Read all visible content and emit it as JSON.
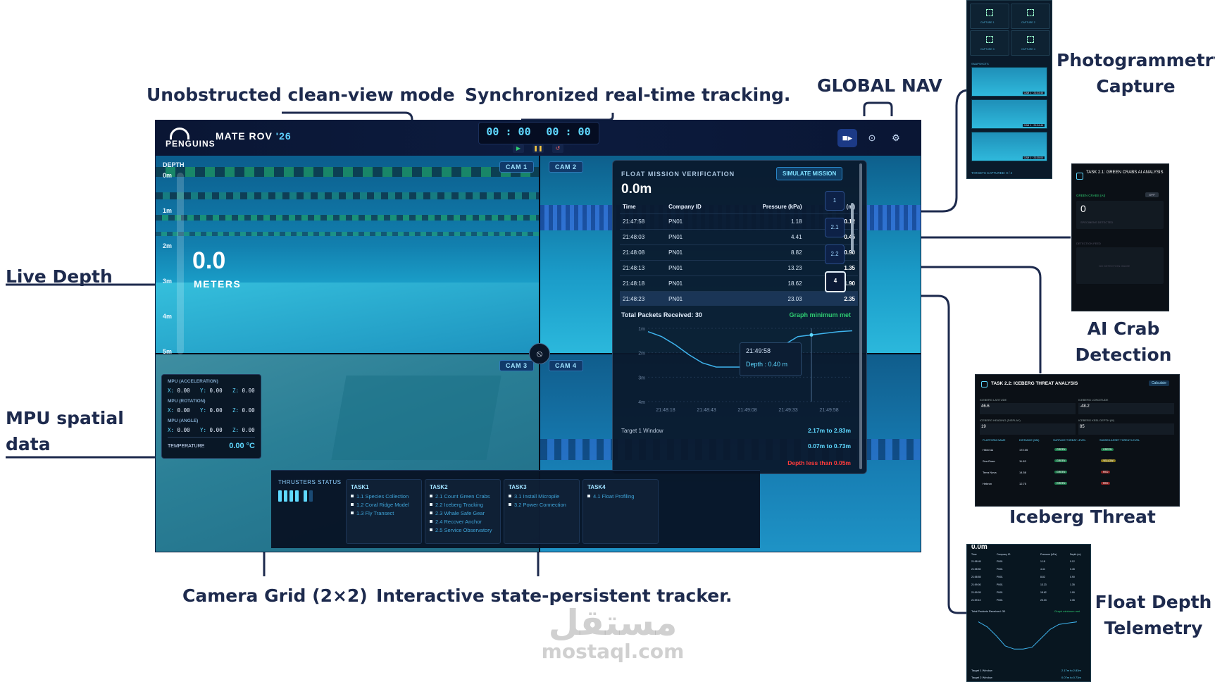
{
  "annotations": {
    "clean_view": "Unobstructed clean-view mode",
    "sync_tracking": "Synchronized real-time tracking.",
    "global_nav": "GLOBAL NAV",
    "photogrammetry": "Photogrammetry Capture",
    "live_depth": "Live Depth",
    "ai_crab": "AI Crab Detection",
    "mpu": "MPU spatial data",
    "iceberg": "Iceberg Threat",
    "camera_grid": "Camera Grid (2×2)",
    "tracker": "Interactive state-persistent tracker.",
    "float_depth": "Float Depth Telemetry"
  },
  "header": {
    "logo_text": "PENGUINS",
    "brand": "MATE ROV",
    "year": "'26",
    "timer_left": "00 : 00",
    "timer_right": "00 : 00",
    "play_icon": "play-icon",
    "pause_icon": "pause-icon",
    "reset_icon": "reset-icon",
    "nav_icons": [
      "camera-icon",
      "gamepad-icon",
      "gear-icon"
    ]
  },
  "cameras": [
    "CAM 1",
    "CAM 2",
    "CAM 3",
    "CAM 4"
  ],
  "depth_gauge": {
    "title": "DEPTH",
    "ticks": [
      "0m",
      "1m",
      "2m",
      "3m",
      "4m",
      "5m"
    ],
    "value": "0.0",
    "unit": "METERS"
  },
  "mpu": {
    "groups": [
      {
        "label": "MPU (ACCELERATION)",
        "x": "0.00",
        "y": "0.00",
        "z": "0.00"
      },
      {
        "label": "MPU (ROTATION)",
        "x": "0.00",
        "y": "0.00",
        "z": "0.00"
      },
      {
        "label": "MPU (ANGLE)",
        "x": "0.00",
        "y": "0.00",
        "z": "0.00"
      }
    ],
    "temp_label": "TEMPERATURE",
    "temp_value": "0.00 °C"
  },
  "float_panel": {
    "title": "FLOAT MISSION VERIFICATION",
    "button": "SIMULATE MISSION",
    "depth": "0.0m",
    "columns": [
      "Time",
      "Company ID",
      "Pressure (kPa)",
      "Depth (m)"
    ],
    "rows": [
      [
        "21:47:58",
        "PN01",
        "1.18",
        "0.12"
      ],
      [
        "21:48:03",
        "PN01",
        "4.41",
        "0.45"
      ],
      [
        "21:48:08",
        "PN01",
        "8.82",
        "0.90"
      ],
      [
        "21:48:13",
        "PN01",
        "13.23",
        "1.35"
      ],
      [
        "21:48:18",
        "PN01",
        "18.62",
        "1.90"
      ],
      [
        "21:48:23",
        "PN01",
        "23.03",
        "2.35"
      ]
    ],
    "packets": "Total Packets Received: 30",
    "graph_status": "Graph minimum met",
    "tooltip_time": "21:49:58",
    "tooltip_depth": "Depth : 0.40 m",
    "y_ticks": [
      "1m",
      "2m",
      "3m",
      "4m"
    ],
    "x_ticks": [
      "21:48:18",
      "21:48:43",
      "21:49:08",
      "21:49:33",
      "21:49:58",
      "21:50:23"
    ],
    "target1_label": "Target 1 Window",
    "target1_value": "2.17m to 2.83m",
    "target2_value": "0.07m to 0.73m",
    "warning": "Depth less than 0.05m"
  },
  "side_tabs": [
    "1",
    "2.1",
    "2.2",
    "4"
  ],
  "thrusters": {
    "label": "THRUSTERS STATUS"
  },
  "tasks": [
    {
      "title": "TASK1",
      "items": [
        "1.1 Species Collection",
        "1.2 Coral Ridge Model",
        "1.3 Fly Transect"
      ]
    },
    {
      "title": "TASK2",
      "items": [
        "2.1 Count Green Crabs",
        "2.2 Iceberg Tracking",
        "2.3 Whale Safe Gear",
        "2.4 Recover Anchor",
        "2.5 Service Observatory"
      ]
    },
    {
      "title": "TASK3",
      "items": [
        "3.1 Install Micropile",
        "3.2 Power Connection"
      ]
    },
    {
      "title": "TASK4",
      "items": [
        "4.1 Float Profiling"
      ]
    }
  ],
  "photogrammetry": {
    "captures": [
      "CAPTURE 1",
      "CAPTURE 2",
      "CAPTURE 3",
      "CAPTURE 4"
    ],
    "snap_label": "SNAPSHOTS",
    "snap_stamps": [
      "CAM 1 · 21:33:46",
      "CAM 1 · 21:34:46",
      "CAM 1 · 21:35:00"
    ],
    "footer": "TARGETS CAPTURED: 0 / 4"
  },
  "ai_crab": {
    "title": "TASK 2.1: GREEN CRABS AI ANALYSIS",
    "subtitle": "GREEN CRABS (AI)",
    "toggle": "OFF",
    "count": "0",
    "count_label": "SPECIMENS DETECTED",
    "feed_label": "DETECTION FEED",
    "feed_empty": "NO DETECTION IMAGE"
  },
  "iceberg_panel": {
    "title": "TASK 2.2: ICEBERG THREAT ANALYSIS",
    "button": "Calculate",
    "lat_label": "ICEBERG LATITUDE",
    "lat": "46.6",
    "lon_label": "ICEBERG LONGITUDE",
    "lon": "-48.2",
    "heading_label": "ICEBERG HEADING (DISPLAY)",
    "heading": "19",
    "keel_label": "ICEBERG KEEL DEPTH (M)",
    "keel": "85",
    "columns": [
      "PLATFORM NAME",
      "DISTANCE (NM)",
      "SURFACE THREAT LEVEL",
      "SUBSEA ASSET THREAT LEVEL"
    ],
    "rows": [
      [
        "Hibernia",
        "172.05",
        "GREEN",
        "GREEN"
      ],
      [
        "Sea Rose",
        "11.63",
        "GREEN",
        "YELLOW"
      ],
      [
        "Terra Nova",
        "14.58",
        "GREEN",
        "RED"
      ],
      [
        "Hebron",
        "12.75",
        "GREEN",
        "RED"
      ]
    ]
  },
  "float_thumb": {
    "depth": "0.0m",
    "columns": [
      "Time",
      "Company ID",
      "Pressure (kPa)",
      "Depth (m)"
    ],
    "rows": [
      [
        "21:58:45",
        "PN01",
        "1.18",
        "0.12"
      ],
      [
        "21:58:50",
        "PN01",
        "4.41",
        "0.45"
      ],
      [
        "21:58:55",
        "PN01",
        "8.82",
        "0.90"
      ],
      [
        "21:59:00",
        "PN01",
        "13.23",
        "1.35"
      ],
      [
        "21:59:05",
        "PN01",
        "18.62",
        "1.90"
      ],
      [
        "21:59:10",
        "PN01",
        "23.03",
        "2.35"
      ]
    ],
    "packets": "Total Packets Received: 30",
    "status": "Graph minimum met",
    "target1": "Target 1 Window",
    "target1_val": "2.17m to 2.83m",
    "target2": "Target 2 Window",
    "target2_val": "0.07m to 0.73m"
  },
  "watermark": {
    "arabic": "مستقل",
    "latin": "mostaql.com"
  },
  "colors": {
    "navy": "#1d2a4d",
    "accent": "#5fd8ff",
    "pool": "#1fa5c8",
    "ok": "#2ecc71",
    "warn": "#ff3b3b"
  }
}
